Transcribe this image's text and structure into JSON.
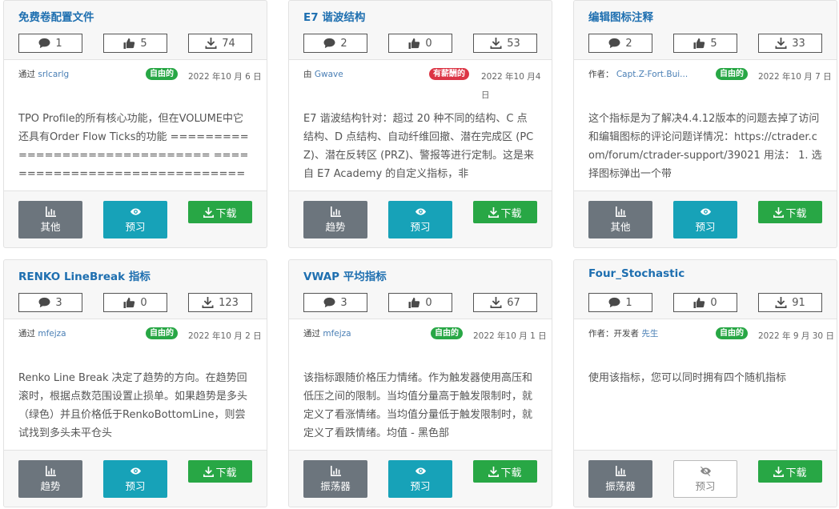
{
  "colors": {
    "title": "#1e6fb0",
    "free_badge": "#28a745",
    "paid_badge": "#dc3545",
    "category": "#6c757d",
    "preview": "#17a2b8",
    "download": "#28a745"
  },
  "cards": [
    {
      "title": "免费卷配置文件",
      "comments": "1",
      "likes": "5",
      "downloads": "74",
      "author_prefix": "通过",
      "author": "srlcarlg",
      "badge": "自由的",
      "badge_type": "free",
      "date": "2022 年10 月 6 日",
      "description": " TPO Profile的所有核心功能，但在VOLUME中它还具有Order Flow Ticks的功能 =============================== ================================",
      "category": "其他",
      "category_icon": "bar-chart-icon",
      "preview": "预习",
      "preview_disabled": false,
      "download": "下载"
    },
    {
      "title": "E7 谐波结构",
      "comments": "2",
      "likes": "0",
      "downloads": "53",
      "author_prefix": "由",
      "author": "Gwave",
      "badge": "有薪酬的",
      "badge_type": "paid",
      "date": "2022 年10 月4 日",
      "description": "E7 谐波结构针对：超过 20 种不同的结构、C 点结构、D 点结构、自动纤维回撤、潜在完成区 (PCZ)、潜在反转区 (PRZ)、警报等进行定制。这是来自 E7 Academy 的自定义指标，非",
      "category": "趋势",
      "category_icon": "bar-chart-icon",
      "preview": "预习",
      "preview_disabled": false,
      "download": "下载"
    },
    {
      "title": "编辑图标注释",
      "comments": "2",
      "likes": "5",
      "downloads": "33",
      "author_prefix": "作者：",
      "author": "Capt.Z-Fort.Bui...",
      "badge": "自由的",
      "badge_type": "free",
      "date": "2022 年10 月 7 日",
      "description": "这个指标是为了解决4.4.12版本的问题去掉了访问和编辑图标的评论问题详情况：https://ctrader.com/forum/ctrader-support/39021 用法： 1. 选择图标弹出一个带",
      "category": "其他",
      "category_icon": "bar-chart-icon",
      "preview": "预习",
      "preview_disabled": false,
      "download": "下载"
    },
    {
      "title": "RENKO LineBreak 指标",
      "comments": "3",
      "likes": "0",
      "downloads": "123",
      "author_prefix": "通过",
      "author": "mfejza",
      "badge": "自由的",
      "badge_type": "free",
      "date": "2022 年10 月 2 日",
      "description": "Renko Line Break 决定了趋势的方向。在趋势回滚时，根据点数范围设置止损单。如果趋势是多头（绿色）并且价格低于RenkoBottomLine，则尝试找到多头未平仓头",
      "category": "趋势",
      "category_icon": "bar-chart-icon",
      "preview": "预习",
      "preview_disabled": false,
      "download": "下载"
    },
    {
      "title": "VWAP 平均指标",
      "comments": "3",
      "likes": "0",
      "downloads": "67",
      "author_prefix": "通过",
      "author": "mfejza",
      "badge": "自由的",
      "badge_type": "free",
      "date": "2022 年10 月 1 日",
      "description": "该指标跟随价格压力情绪。作为触发器使用高压和低压之间的限制。当均值分量高于触发限制时，就定义了看涨情绪。当均值分量低于触发限制时，就定义了看跌情绪。均值 - 黑色部",
      "category": "振荡器",
      "category_icon": "bar-chart-icon",
      "preview": "预习",
      "preview_disabled": false,
      "download": "下载"
    },
    {
      "title": "Four_Stochastic",
      "comments": "1",
      "likes": "0",
      "downloads": "91",
      "author_prefix": "作者：开发者",
      "author": "先生",
      "badge": "自由的",
      "badge_type": "free",
      "date": "2022 年 9 月 30 日",
      "description": "使用该指标，您可以同时拥有四个随机指标",
      "category": "振荡器",
      "category_icon": "bar-chart-icon",
      "preview": "预习",
      "preview_disabled": true,
      "download": "下载"
    }
  ]
}
